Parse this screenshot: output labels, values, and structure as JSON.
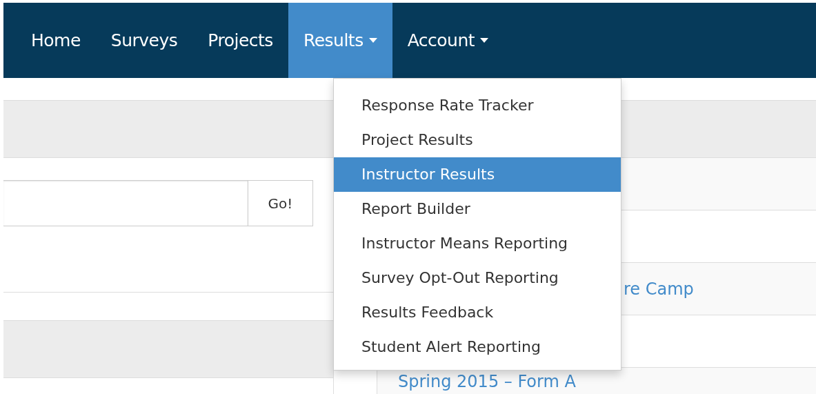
{
  "nav": {
    "items": [
      {
        "label": "Home",
        "selected": false,
        "dropdown": false
      },
      {
        "label": "Surveys",
        "selected": false,
        "dropdown": false
      },
      {
        "label": "Projects",
        "selected": false,
        "dropdown": false
      },
      {
        "label": "Results",
        "selected": true,
        "dropdown": true
      },
      {
        "label": "Account",
        "selected": false,
        "dropdown": true
      }
    ]
  },
  "results_menu": {
    "items": [
      {
        "label": "Response Rate Tracker",
        "selected": false
      },
      {
        "label": "Project Results",
        "selected": false
      },
      {
        "label": "Instructor Results",
        "selected": true
      },
      {
        "label": "Report Builder",
        "selected": false
      },
      {
        "label": "Instructor Means Reporting",
        "selected": false
      },
      {
        "label": "Survey Opt-Out Reporting",
        "selected": false
      },
      {
        "label": "Results Feedback",
        "selected": false
      },
      {
        "label": "Student Alert Reporting",
        "selected": false
      }
    ]
  },
  "search": {
    "button": "Go!"
  },
  "project_list": {
    "rows": [
      {
        "link": "re Camp"
      },
      {
        "link": "Spring 2015 – Form A"
      }
    ]
  }
}
